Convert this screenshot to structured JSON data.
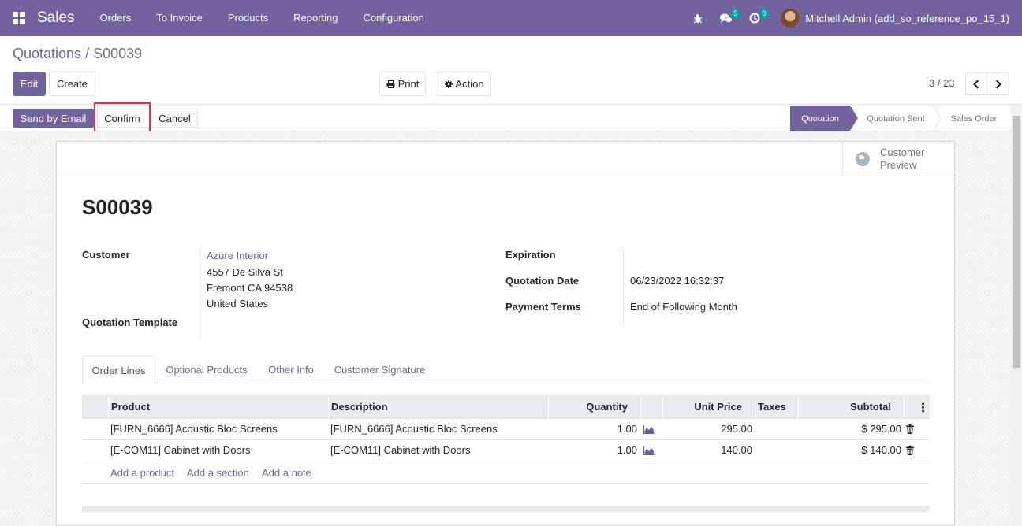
{
  "navbar": {
    "app_name": "Sales",
    "menu": [
      "Orders",
      "To Invoice",
      "Products",
      "Reporting",
      "Configuration"
    ],
    "messages_badge": "5",
    "activities_badge": "8",
    "user": "Mitchell Admin (add_so_reference_po_15_1)"
  },
  "breadcrumb": {
    "parent": "Quotations",
    "separator": "/",
    "current": "S00039"
  },
  "control": {
    "edit": "Edit",
    "create": "Create",
    "print": "Print",
    "action": "Action",
    "pager": "3 / 23"
  },
  "statusbar": {
    "send_email": "Send by Email",
    "confirm": "Confirm",
    "cancel": "Cancel",
    "stages": [
      "Quotation",
      "Quotation Sent",
      "Sales Order"
    ],
    "active_stage": "Quotation"
  },
  "form": {
    "preview_line1": "Customer",
    "preview_line2": "Preview",
    "name": "S00039",
    "customer_label": "Customer",
    "customer_name": "Azure Interior",
    "address_line1": "4557 De Silva St",
    "address_line2": "Fremont CA 94538",
    "address_line3": "United States",
    "template_label": "Quotation Template",
    "expiration_label": "Expiration",
    "quotation_date_label": "Quotation Date",
    "quotation_date": "06/23/2022 16:32:37",
    "payment_terms_label": "Payment Terms",
    "payment_terms": "End of Following Month"
  },
  "tabs": [
    "Order Lines",
    "Optional Products",
    "Other Info",
    "Customer Signature"
  ],
  "table": {
    "headers": {
      "product": "Product",
      "description": "Description",
      "quantity": "Quantity",
      "unit_price": "Unit Price",
      "taxes": "Taxes",
      "subtotal": "Subtotal"
    },
    "rows": [
      {
        "product": "[FURN_6666] Acoustic Bloc Screens",
        "description": "[FURN_6666] Acoustic Bloc Screens",
        "quantity": "1.00",
        "unit_price": "295.00",
        "taxes": "",
        "subtotal": "$ 295.00"
      },
      {
        "product": "[E-COM11] Cabinet with Doors",
        "description": "[E-COM11] Cabinet with Doors",
        "quantity": "1.00",
        "unit_price": "140.00",
        "taxes": "",
        "subtotal": "$ 140.00"
      }
    ],
    "add_product": "Add a product",
    "add_section": "Add a section",
    "add_note": "Add a note"
  },
  "colors": {
    "brand": "#71639e",
    "highlight": "#dc3545"
  }
}
